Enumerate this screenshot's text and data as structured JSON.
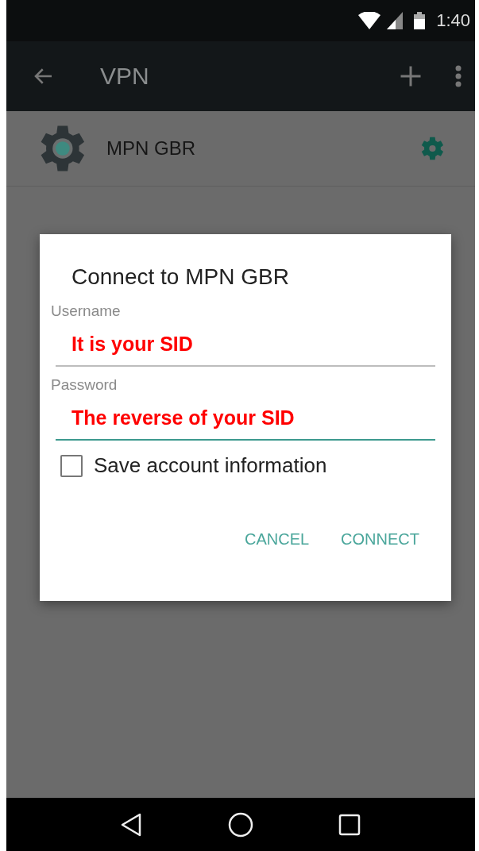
{
  "status_bar": {
    "time": "1:40"
  },
  "toolbar": {
    "title": "VPN"
  },
  "vpn_list": [
    {
      "name": "MPN GBR"
    }
  ],
  "dialog": {
    "title": "Connect to MPN GBR",
    "fields": [
      {
        "label": "Username",
        "value": "It is your SID",
        "focused": false
      },
      {
        "label": "Password",
        "value": "The reverse of your SID",
        "focused": true
      }
    ],
    "save_account": {
      "label": "Save account information",
      "checked": false
    },
    "buttons": [
      "CANCEL",
      "CONNECT"
    ]
  }
}
